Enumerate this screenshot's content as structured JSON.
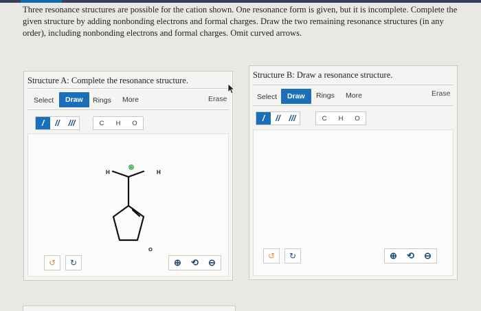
{
  "question": {
    "text": "Three resonance structures are possible for the cation shown. One resonance form is given, but it is incomplete. Complete the given structure by adding nonbonding electrons and formal charges. Draw the two remaining resonance structures (in any order), including nonbonding electrons and formal charges. Omit curved arrows."
  },
  "panel_a": {
    "title": "Structure A: Complete the resonance structure.",
    "toolbar": {
      "select": "Select",
      "draw": "Draw",
      "rings": "Rings",
      "more": "More",
      "erase": "Erase"
    },
    "bonds": [
      "/",
      "//",
      "///"
    ],
    "atoms": [
      "C",
      "H",
      "O"
    ],
    "molecule": {
      "h_left": "H",
      "h_right": "H",
      "oxygen": "O",
      "charge": "+"
    }
  },
  "panel_b": {
    "title": "Structure B: Draw a resonance structure.",
    "toolbar": {
      "select": "Select",
      "draw": "Draw",
      "rings": "Rings",
      "more": "More",
      "erase": "Erase"
    },
    "bonds": [
      "/",
      "//",
      "///"
    ],
    "atoms": [
      "C",
      "H",
      "O"
    ]
  },
  "icons": {
    "undo": "undo-icon",
    "redo": "redo-icon",
    "zoom_in": "zoom-in-icon",
    "zoom_reset": "zoom-reset-icon",
    "zoom_out": "zoom-out-icon"
  },
  "colors": {
    "accent": "#1a6fb8",
    "header": "#3a3f55"
  }
}
